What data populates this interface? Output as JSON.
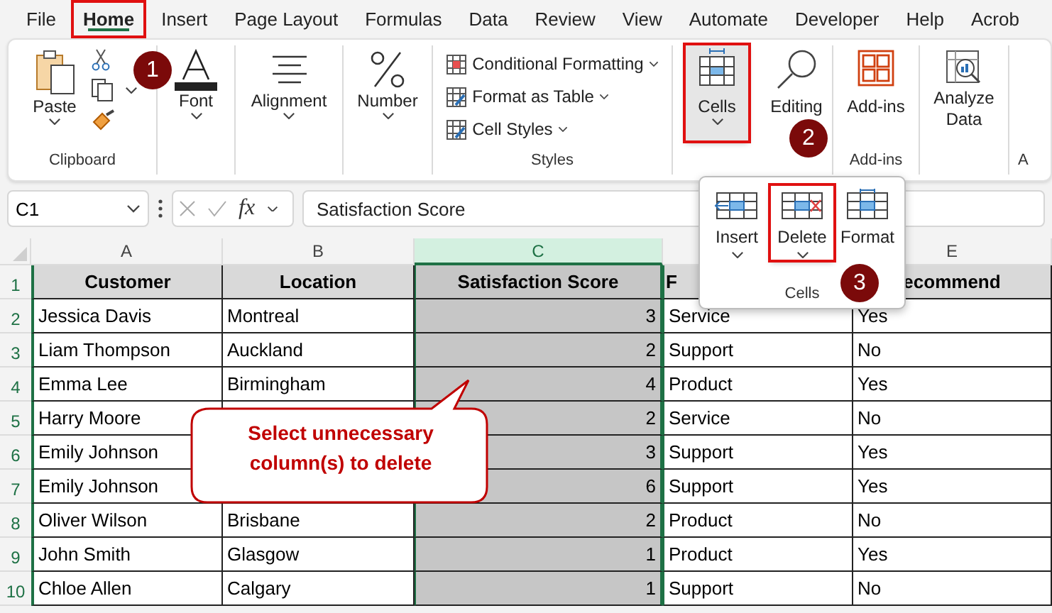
{
  "menu_tabs": [
    {
      "label": "File",
      "selected": false,
      "highlighted": false
    },
    {
      "label": "Home",
      "selected": true,
      "highlighted": true
    },
    {
      "label": "Insert",
      "selected": false,
      "highlighted": false
    },
    {
      "label": "Page Layout",
      "selected": false,
      "highlighted": false
    },
    {
      "label": "Formulas",
      "selected": false,
      "highlighted": false
    },
    {
      "label": "Data",
      "selected": false,
      "highlighted": false
    },
    {
      "label": "Review",
      "selected": false,
      "highlighted": false
    },
    {
      "label": "View",
      "selected": false,
      "highlighted": false
    },
    {
      "label": "Automate",
      "selected": false,
      "highlighted": false
    },
    {
      "label": "Developer",
      "selected": false,
      "highlighted": false
    },
    {
      "label": "Help",
      "selected": false,
      "highlighted": false
    },
    {
      "label": "Acrob",
      "selected": false,
      "highlighted": false
    }
  ],
  "ribbon_groups": [
    {
      "kind": "clipboard",
      "button": "Paste",
      "label": "Clipboard"
    },
    {
      "kind": "font",
      "button": "Font"
    },
    {
      "kind": "alignment",
      "button": "Alignment"
    },
    {
      "kind": "number",
      "button": "Number"
    },
    {
      "kind": "styles",
      "items": [
        "Conditional Formatting",
        "Format as Table",
        "Cell Styles"
      ],
      "label": "Styles"
    },
    {
      "kind": "cells",
      "button": "Cells",
      "highlighted": true
    },
    {
      "kind": "editing",
      "button": "Editing"
    },
    {
      "kind": "addins",
      "button": "Add-ins",
      "label": "Add-ins"
    },
    {
      "kind": "analyze",
      "button": "Analyze Data"
    },
    {
      "kind": "partial",
      "label": "A"
    }
  ],
  "formula_bar": {
    "name_box": "C1",
    "fx": "fx",
    "formula": "Satisfaction Score"
  },
  "columns": [
    {
      "letter": "A",
      "selected": false
    },
    {
      "letter": "B",
      "selected": false
    },
    {
      "letter": "C",
      "selected": true
    },
    {
      "selected": false
    },
    {
      "letter": "E",
      "selected": false
    }
  ],
  "rows": [
    {
      "number": "1",
      "kind": "header",
      "cells": [
        "Customer",
        "Location",
        "Satisfaction Score",
        "F",
        "ecommend"
      ]
    },
    {
      "number": "2",
      "kind": "data",
      "cells": [
        "Jessica Davis",
        "Montreal",
        "3",
        "Service",
        "Yes"
      ]
    },
    {
      "number": "3",
      "kind": "data",
      "cells": [
        "Liam Thompson",
        "Auckland",
        "2",
        "Support",
        "No"
      ]
    },
    {
      "number": "4",
      "kind": "data",
      "cells": [
        "Emma Lee",
        "Birmingham",
        "4",
        "Product",
        "Yes"
      ]
    },
    {
      "number": "5",
      "kind": "data",
      "cells": [
        "Harry Moore",
        null,
        "2",
        "Service",
        "No"
      ]
    },
    {
      "number": "6",
      "kind": "data",
      "cells": [
        "Emily Johnson",
        null,
        "3",
        "Support",
        "Yes"
      ]
    },
    {
      "number": "7",
      "kind": "data",
      "cells": [
        "Emily Johnson",
        null,
        "6",
        "Support",
        "Yes"
      ]
    },
    {
      "number": "8",
      "kind": "data",
      "cells": [
        "Oliver Wilson",
        "Brisbane",
        "2",
        "Product",
        "No"
      ]
    },
    {
      "number": "9",
      "kind": "data",
      "cells": [
        "John Smith",
        "Glasgow",
        "1",
        "Product",
        "Yes"
      ]
    },
    {
      "number": "10",
      "kind": "data",
      "cells": [
        "Chloe Allen",
        "Calgary",
        "1",
        "Support",
        "No"
      ]
    }
  ],
  "cells_popup": {
    "buttons": [
      {
        "label": "Insert",
        "highlighted": false
      },
      {
        "label": "Delete",
        "highlighted": true
      },
      {
        "label": "Format",
        "highlighted": false
      }
    ],
    "label": "Cells"
  },
  "callout": {
    "text": "Select unnecessary column(s) to delete"
  },
  "step_badges": [
    "1",
    "2",
    "3"
  ]
}
